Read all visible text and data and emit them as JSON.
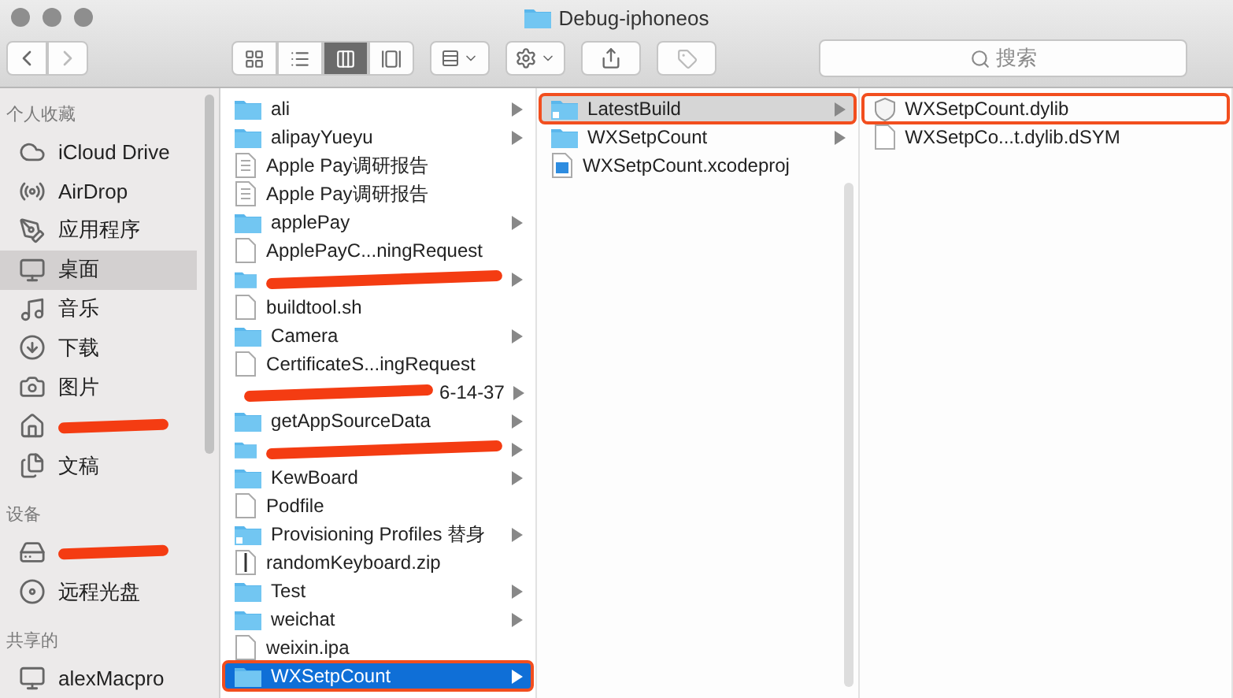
{
  "window": {
    "title": "Debug-iphoneos"
  },
  "toolbar": {
    "views": [
      {
        "kind": "icons",
        "selected": false
      },
      {
        "kind": "list",
        "selected": false
      },
      {
        "kind": "columns",
        "selected": true
      },
      {
        "kind": "gallery",
        "selected": false
      }
    ],
    "search": {
      "placeholder": "搜索"
    }
  },
  "sidebar": {
    "sections": [
      {
        "title": "个人收藏",
        "items": [
          {
            "kind": "cloud",
            "label": "iCloud Drive",
            "selected": false
          },
          {
            "kind": "airdrop",
            "label": "AirDrop",
            "selected": false
          },
          {
            "kind": "apps",
            "label": "应用程序",
            "selected": false
          },
          {
            "kind": "desktop",
            "label": "桌面",
            "selected": true
          },
          {
            "kind": "music",
            "label": "音乐",
            "selected": false
          },
          {
            "kind": "download",
            "label": "下载",
            "selected": false
          },
          {
            "kind": "camera",
            "label": "图片",
            "selected": false
          },
          {
            "kind": "home",
            "redacted": true,
            "selected": false
          },
          {
            "kind": "docs",
            "label": "文稿",
            "selected": false
          }
        ]
      },
      {
        "title": "设备",
        "items": [
          {
            "kind": "drive",
            "redacted": true,
            "selected": false
          },
          {
            "kind": "disc",
            "label": "远程光盘",
            "selected": false
          }
        ]
      },
      {
        "title": "共享的",
        "items": [
          {
            "kind": "computer",
            "label": "alexMacpro",
            "selected": false
          }
        ]
      }
    ]
  },
  "columns": [
    {
      "active": true,
      "items": [
        {
          "kind": "folder",
          "name": "ali",
          "arrow": true,
          "selected": false
        },
        {
          "kind": "folder",
          "name": "alipayYueyu",
          "arrow": true,
          "selected": false
        },
        {
          "kind": "doc",
          "name": "Apple Pay调研报告",
          "arrow": false,
          "selected": false
        },
        {
          "kind": "doc",
          "name": "Apple Pay调研报告",
          "arrow": false,
          "selected": false
        },
        {
          "kind": "folder",
          "name": "applePay",
          "arrow": true,
          "selected": false
        },
        {
          "kind": "file",
          "name": "ApplePayC...ningRequest",
          "arrow": false,
          "selected": false
        },
        {
          "kind": "folder",
          "redacted": true,
          "arrow": true,
          "selected": false
        },
        {
          "kind": "file",
          "name": "buildtool.sh",
          "arrow": false,
          "selected": false
        },
        {
          "kind": "folder",
          "name": "Camera",
          "arrow": true,
          "selected": false
        },
        {
          "kind": "file",
          "name": "CertificateS...ingRequest",
          "arrow": false,
          "selected": false
        },
        {
          "kind": "folder",
          "name": "6-14-37",
          "redacted": true,
          "arrow": true,
          "selected": false
        },
        {
          "kind": "folder",
          "name": "getAppSourceData",
          "arrow": true,
          "selected": false
        },
        {
          "kind": "folder",
          "redacted": true,
          "arrow": true,
          "selected": false
        },
        {
          "kind": "folder",
          "name": "KewBoard",
          "arrow": true,
          "selected": false
        },
        {
          "kind": "file",
          "name": "Podfile",
          "arrow": false,
          "selected": false
        },
        {
          "kind": "alias",
          "name": "Provisioning Profiles 替身",
          "arrow": true,
          "selected": false
        },
        {
          "kind": "zip",
          "name": "randomKeyboard.zip",
          "arrow": false,
          "selected": false
        },
        {
          "kind": "folder",
          "name": "Test",
          "arrow": true,
          "selected": false
        },
        {
          "kind": "folder",
          "name": "weichat",
          "arrow": true,
          "selected": false
        },
        {
          "kind": "file",
          "name": "weixin.ipa",
          "arrow": false,
          "selected": false
        },
        {
          "kind": "folder",
          "name": "WXSetpCount",
          "arrow": true,
          "selected": true,
          "annotated": true
        }
      ]
    },
    {
      "active": false,
      "items": [
        {
          "kind": "alias",
          "name": "LatestBuild",
          "arrow": true,
          "selected": true,
          "annotated": true
        },
        {
          "kind": "folder",
          "name": "WXSetpCount",
          "arrow": true,
          "selected": false
        },
        {
          "kind": "xcodeproj",
          "name": "WXSetpCount.xcodeproj",
          "arrow": false,
          "selected": false
        }
      ]
    },
    {
      "active": false,
      "items": [
        {
          "kind": "dylib",
          "name": "WXSetpCount.dylib",
          "arrow": false,
          "selected": false,
          "annotated": true
        },
        {
          "kind": "file",
          "name": "WXSetpCo...t.dylib.dSYM",
          "arrow": false,
          "selected": false
        }
      ]
    }
  ]
}
